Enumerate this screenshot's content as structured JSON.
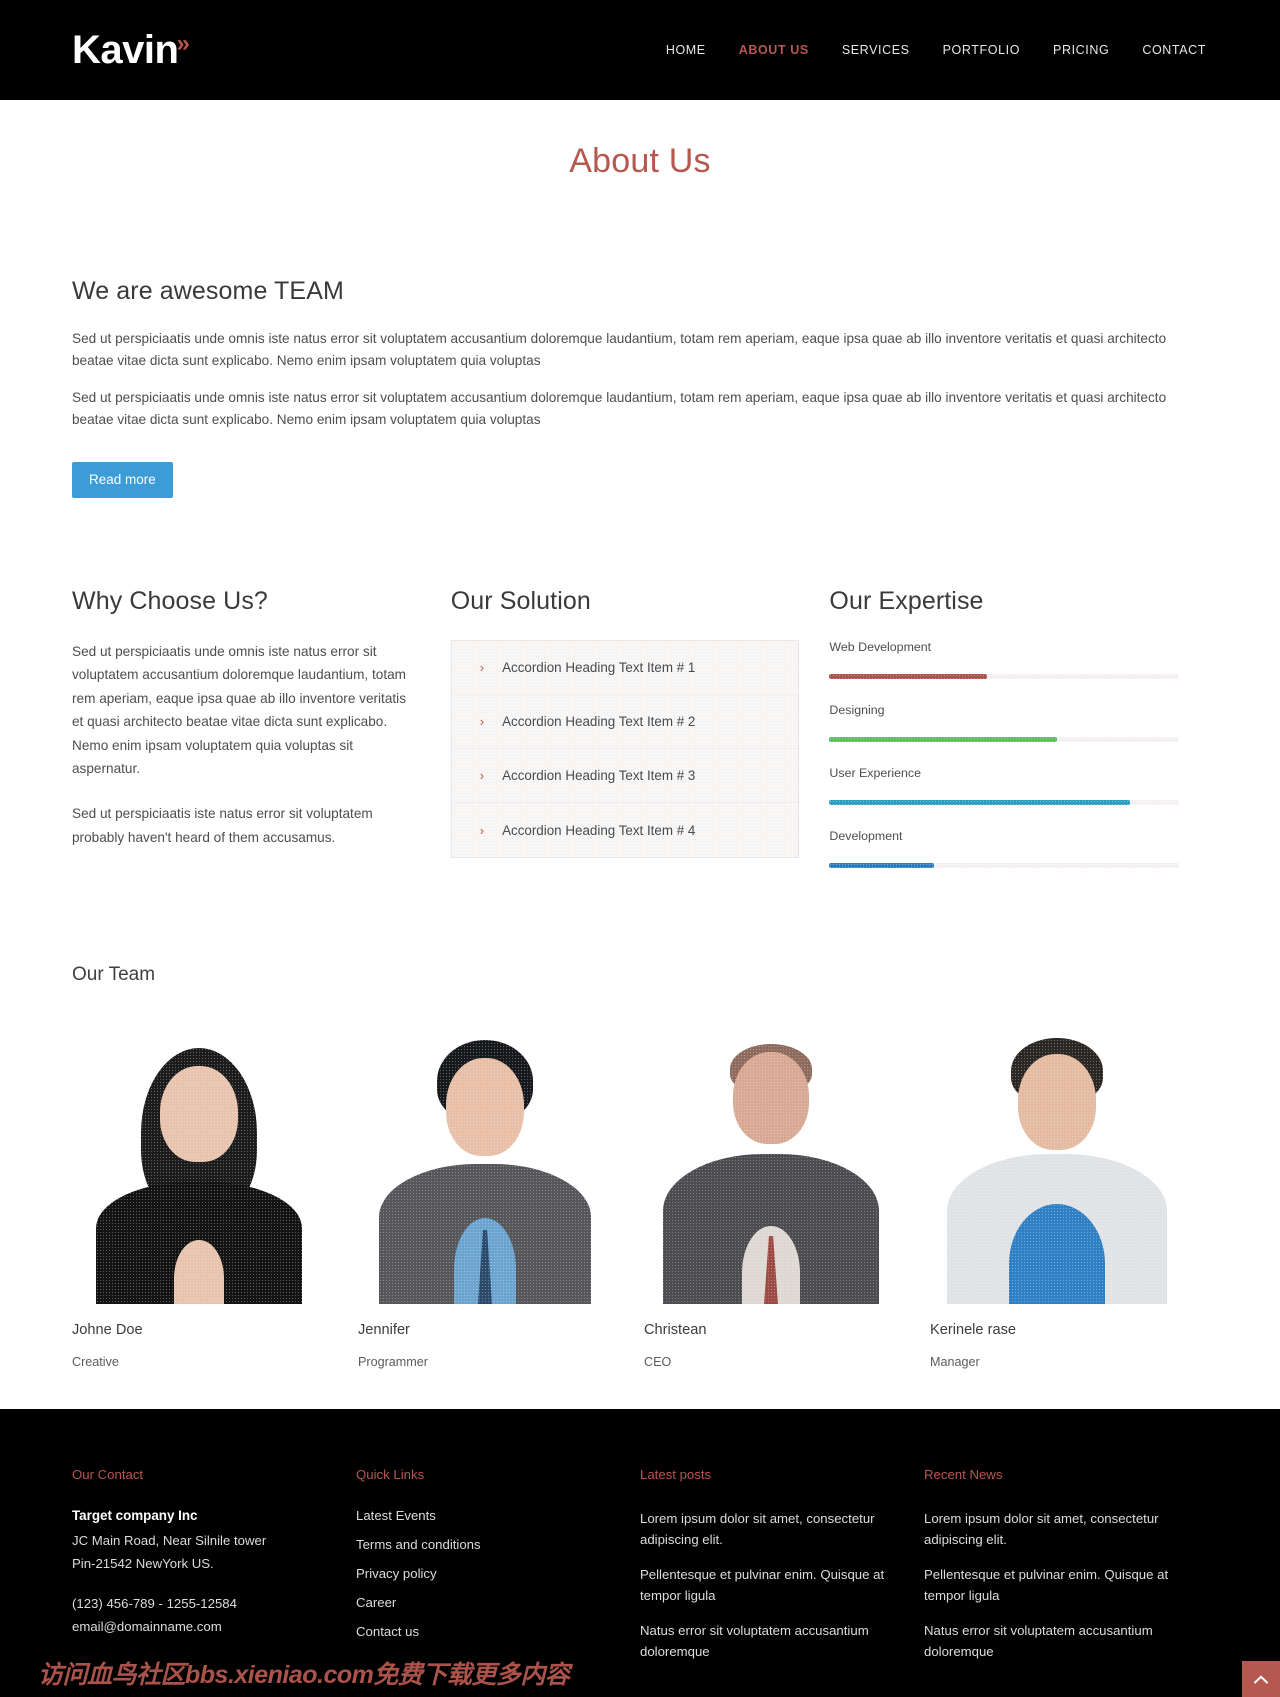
{
  "header": {
    "logo_text": "Kavin",
    "logo_chevron": "»",
    "nav": [
      {
        "label": "HOME",
        "active": false
      },
      {
        "label": "ABOUT US",
        "active": true
      },
      {
        "label": "SERVICES",
        "active": false
      },
      {
        "label": "PORTFOLIO",
        "active": false
      },
      {
        "label": "PRICING",
        "active": false
      },
      {
        "label": "CONTACT",
        "active": false
      }
    ]
  },
  "page": {
    "title": "About Us"
  },
  "intro": {
    "heading": "We are awesome TEAM",
    "paragraph_1": "Sed ut perspiciaatis unde omnis iste natus error sit voluptatem accusantium doloremque laudantium, totam rem aperiam, eaque ipsa quae ab illo inventore veritatis et quasi architecto beatae vitae dicta sunt explicabo. Nemo enim ipsam voluptatem quia voluptas",
    "paragraph_2": "Sed ut perspiciaatis unde omnis iste natus error sit voluptatem accusantium doloremque laudantium, totam rem aperiam, eaque ipsa quae ab illo inventore veritatis et quasi architecto beatae vitae dicta sunt explicabo. Nemo enim ipsam voluptatem quia voluptas",
    "read_more_label": "Read more",
    "read_more_color": "#3c9cd7"
  },
  "why_choose": {
    "heading": "Why Choose Us?",
    "paragraph_1": "Sed ut perspiciaatis unde omnis iste natus error sit voluptatem accusantium doloremque laudantium, totam rem aperiam, eaque ipsa quae ab illo inventore veritatis et quasi architecto beatae vitae dicta sunt explicabo. Nemo enim ipsam voluptatem quia voluptas sit aspernatur.",
    "paragraph_2": "Sed ut perspiciaatis iste natus error sit voluptatem probably haven't heard of them accusamus."
  },
  "solution": {
    "heading": "Our Solution",
    "chevron": "›",
    "items": [
      {
        "label": "Accordion Heading Text Item # 1"
      },
      {
        "label": "Accordion Heading Text Item # 2"
      },
      {
        "label": "Accordion Heading Text Item # 3"
      },
      {
        "label": "Accordion Heading Text Item # 4"
      }
    ]
  },
  "expertise": {
    "heading": "Our Expertise",
    "skills": [
      {
        "label": "Web Development",
        "percent": 45,
        "color": "#a9534a"
      },
      {
        "label": "Designing",
        "percent": 65,
        "color": "#4cc45f"
      },
      {
        "label": "User Experience",
        "percent": 86,
        "color": "#2e9ec0"
      },
      {
        "label": "Development",
        "percent": 30,
        "color": "#2a7fc4"
      }
    ]
  },
  "team": {
    "heading": "Our Team",
    "members": [
      {
        "name": "Johne Doe",
        "role": "Creative"
      },
      {
        "name": "Jennifer",
        "role": "Programmer"
      },
      {
        "name": "Christean",
        "role": "CEO"
      },
      {
        "name": "Kerinele rase",
        "role": "Manager"
      }
    ]
  },
  "footer": {
    "contact": {
      "heading": "Our Contact",
      "company": "Target company Inc",
      "address_line_1": "JC Main Road, Near Silnile tower",
      "address_line_2": "Pin-21542 NewYork US.",
      "phone": "(123) 456-789 - 1255-12584",
      "email": "email@domainname.com"
    },
    "quick_links": {
      "heading": "Quick Links",
      "links": [
        "Latest Events",
        "Terms and conditions",
        "Privacy policy",
        "Career",
        "Contact us"
      ]
    },
    "latest_posts": {
      "heading": "Latest posts",
      "posts": [
        "Lorem ipsum dolor sit amet, consectetur adipiscing elit.",
        "Pellentesque et pulvinar enim. Quisque at tempor ligula",
        "Natus error sit voluptatem accusantium doloremque"
      ]
    },
    "recent_news": {
      "heading": "Recent News",
      "posts": [
        "Lorem ipsum dolor sit amet, consectetur adipiscing elit.",
        "Pellentesque et pulvinar enim. Quisque at tempor ligula",
        "Natus error sit voluptatem accusantium doloremque"
      ]
    }
  },
  "watermark": {
    "text": "访问血鸟社区bbs.xieniao.com免费下载更多内容"
  },
  "accent_color": "#b5584f"
}
